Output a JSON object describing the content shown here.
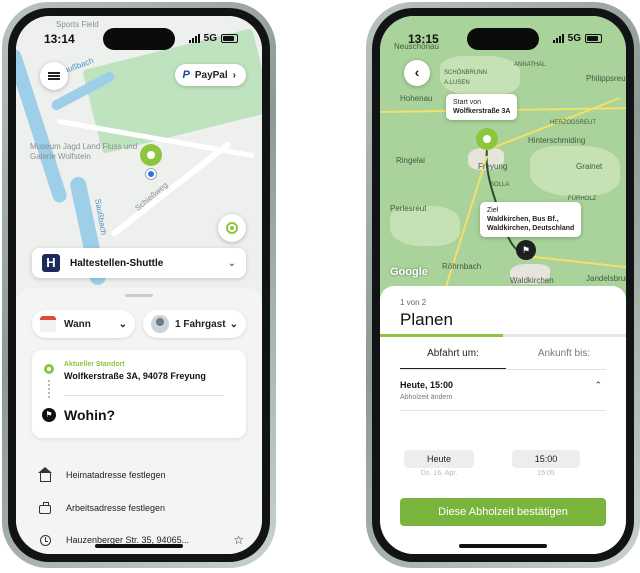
{
  "left_phone": {
    "status": {
      "time": "13:14",
      "network": "5G"
    },
    "map": {
      "labels": {
        "top": "Sports Field",
        "river_top": "Saußbach",
        "museum": "Museum Jagd Land Fluss und Galerie Wolfstein",
        "river_side": "Saußbach",
        "street": "Schießweg"
      }
    },
    "paypal": {
      "logo": "P",
      "label": "PayPal",
      "chevron": "›"
    },
    "shuttle": {
      "letter": "H",
      "title": "Haltestellen-Shuttle",
      "chevron": "⌄"
    },
    "selectors": {
      "when": {
        "label": "Wann",
        "chevron": "⌄"
      },
      "passengers": {
        "label": "1 Fahrgast",
        "chevron": "⌄"
      }
    },
    "route": {
      "start_label": "Aktueller Standort",
      "start_address": "Wolfkerstraße 3A, 94078 Freyung",
      "destination_prompt": "Wohin?"
    },
    "shortcuts": [
      {
        "label": "Heimatadresse festlegen"
      },
      {
        "label": "Arbeitsadresse festlegen"
      },
      {
        "label": "Hauzenberger Str. 35, 94065...",
        "star": "☆"
      }
    ]
  },
  "right_phone": {
    "status": {
      "time": "13:15",
      "network": "5G"
    },
    "back": "‹",
    "map": {
      "labels": {
        "l1": "Neuschönau",
        "l2": "Hohenau",
        "l3": "SCHÖNBRUNN A.LUSEN",
        "l4": "ANNATHAL",
        "l5": "Philippsreut",
        "l6": "HERZOGSREUT",
        "l7": "Ringelai",
        "l8": "Freyung",
        "l9": "Hinterschmiding",
        "l10": "SOLLA",
        "l11": "Grainet",
        "l12": "FÜRHOLZ",
        "l13": "Perlesreut",
        "l14": "Röhrnbach",
        "l15": "Waldkirchen",
        "l16": "Jandelsbrunn"
      },
      "start_callout": {
        "title": "Start von",
        "address": "Wolfkerstraße 3A"
      },
      "dest_callout": {
        "title": "Ziel",
        "line1": "Waldkirchen, Bus Bf.,",
        "line2": "Waldkirchen, Deutschland"
      },
      "google": "Google"
    },
    "sheet": {
      "step": "1 von 2",
      "title": "Planen",
      "progress": 0.5,
      "tabs": {
        "departure": "Abfahrt um:",
        "arrival": "Ankunft bis:"
      },
      "pickup": {
        "heading": "Heute, 15:00",
        "change": "Abholzeit ändern",
        "caret": "⌃"
      },
      "picker": {
        "day_selected": "Heute",
        "time_selected": "15:00",
        "day_next": "Do. 16. Apr.",
        "time_next": "15:05"
      },
      "confirm": "Diese Abholzeit bestätigen"
    }
  },
  "colors": {
    "accent_green": "#8cc63f",
    "button_green": "#79b43c",
    "shuttle_navy": "#1a2b5c"
  }
}
